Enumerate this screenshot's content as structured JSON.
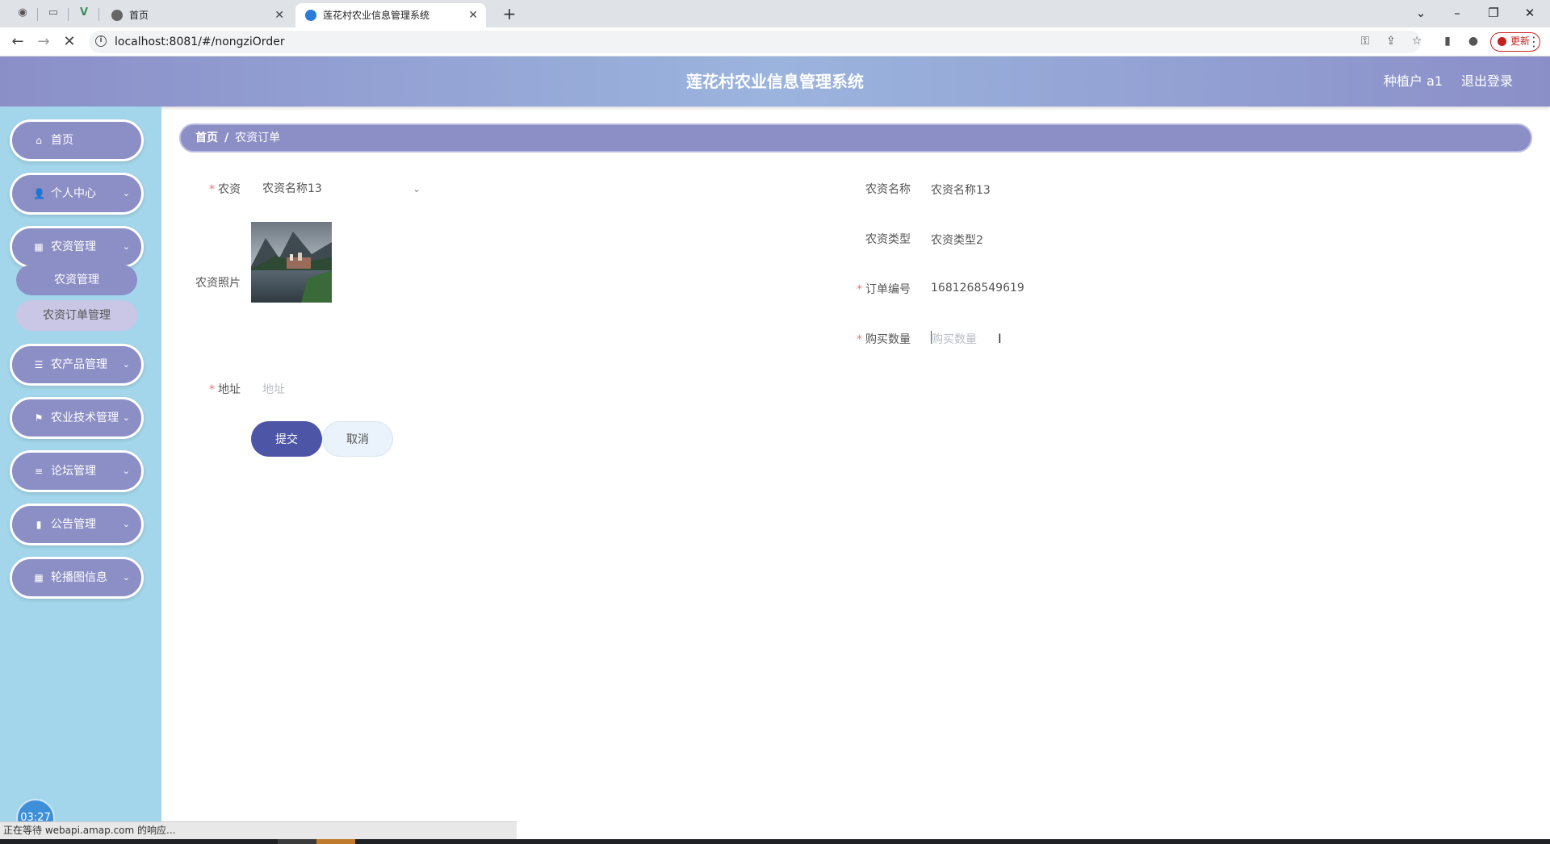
{
  "browser": {
    "tabs": [
      {
        "title": "首页",
        "active": false
      },
      {
        "title": "莲花村农业信息管理系统",
        "active": true
      }
    ],
    "url": "localhost:8081/#/nongziOrder",
    "update_label": "更新"
  },
  "header": {
    "title": "莲花村农业信息管理系统",
    "user": "种植户 a1",
    "logout": "退出登录"
  },
  "sidebar": {
    "items": [
      {
        "label": "首页",
        "icon": "home-icon"
      },
      {
        "label": "个人中心",
        "icon": "user-icon"
      },
      {
        "label": "农资管理",
        "icon": "grid-icon"
      },
      {
        "label": "农产品管理",
        "icon": "sliders-icon"
      },
      {
        "label": "农业技术管理",
        "icon": "flag-icon"
      },
      {
        "label": "论坛管理",
        "icon": "list-icon"
      },
      {
        "label": "公告管理",
        "icon": "bar-chart-icon"
      },
      {
        "label": "轮播图信息",
        "icon": "grid-icon"
      }
    ],
    "subitems": [
      {
        "label": "农资管理",
        "active": true
      },
      {
        "label": "农资订单管理",
        "active": false
      }
    ],
    "clock": "03:27"
  },
  "breadcrumb": {
    "home": "首页",
    "separator": "/",
    "current": "农资订单"
  },
  "form": {
    "nongzi": {
      "label": "农资",
      "value": "农资名称13"
    },
    "nongzi_name": {
      "label": "农资名称",
      "value": "农资名称13"
    },
    "nongzi_type": {
      "label": "农资类型",
      "value": "农资类型2"
    },
    "photo": {
      "label": "农资照片"
    },
    "order_no": {
      "label": "订单编号",
      "value": "1681268549619"
    },
    "quantity": {
      "label": "购买数量",
      "placeholder": "购买数量"
    },
    "address": {
      "label": "地址",
      "placeholder": "地址"
    },
    "submit": "提交",
    "cancel": "取消"
  },
  "status_bar": "正在等待 webapi.amap.com 的响应..."
}
